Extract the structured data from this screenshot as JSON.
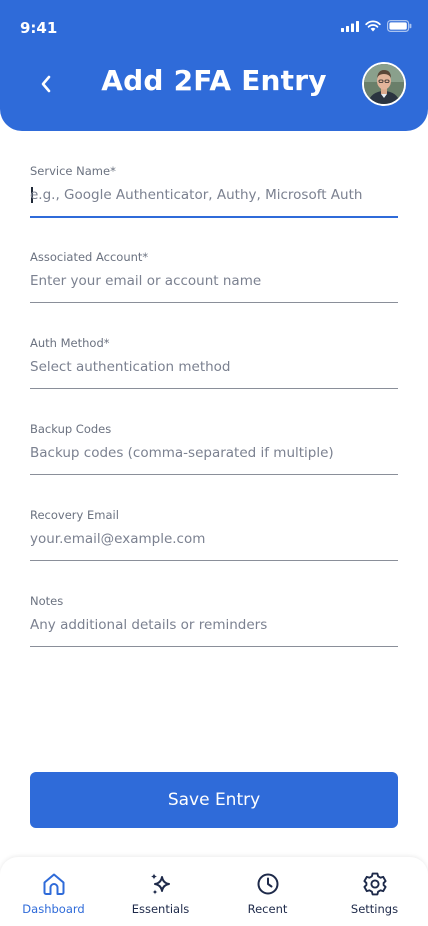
{
  "status_bar": {
    "time": "9:41"
  },
  "header": {
    "title": "Add 2FA Entry"
  },
  "form": {
    "fields": [
      {
        "label": "Service Name*",
        "placeholder": "e.g., Google Authenticator, Authy, Microsoft Auth",
        "value": ""
      },
      {
        "label": "Associated Account*",
        "placeholder": "Enter your email or account name",
        "value": ""
      },
      {
        "label": "Auth Method*",
        "placeholder": "Select authentication method",
        "value": ""
      },
      {
        "label": "Backup Codes",
        "placeholder": "Backup codes (comma-separated if multiple)",
        "value": ""
      },
      {
        "label": "Recovery Email",
        "placeholder": "your.email@example.com",
        "value": ""
      },
      {
        "label": "Notes",
        "placeholder": "Any additional details or reminders",
        "value": ""
      }
    ],
    "submit_label": "Save Entry"
  },
  "bottom_nav": {
    "items": [
      {
        "label": "Dashboard",
        "icon": "home-icon",
        "active": true
      },
      {
        "label": "Essentials",
        "icon": "sparkle-icon",
        "active": false
      },
      {
        "label": "Recent",
        "icon": "clock-icon",
        "active": false
      },
      {
        "label": "Settings",
        "icon": "gear-icon",
        "active": false
      }
    ]
  },
  "colors": {
    "primary": "#2f6bd9",
    "nav_inactive": "#1e2a4a",
    "label": "#6b7280",
    "divider": "#8a8f99"
  }
}
